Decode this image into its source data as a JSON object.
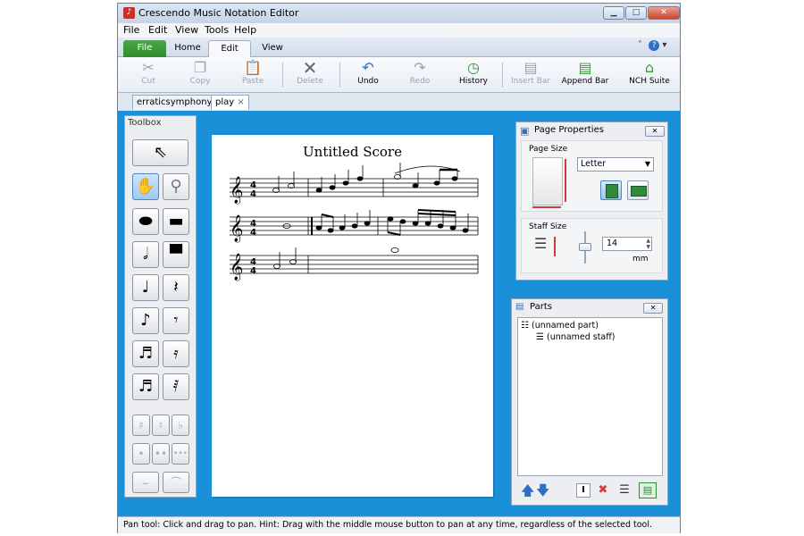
{
  "window": {
    "title": "Crescendo Music Notation Editor"
  },
  "menu": [
    "File",
    "Edit",
    "View",
    "Tools",
    "Help"
  ],
  "ribbon_tabs": {
    "file": "File",
    "home": "Home",
    "edit": "Edit",
    "view": "View"
  },
  "ribbon": {
    "cut": "Cut",
    "copy": "Copy",
    "paste": "Paste",
    "delete": "Delete",
    "undo": "Undo",
    "redo": "Redo",
    "history": "History",
    "insert_bar": "Insert Bar",
    "append_bar": "Append Bar",
    "nch_suite": "NCH Suite"
  },
  "doc_tabs": {
    "first": "erraticsymphony",
    "second": "play"
  },
  "toolbox": {
    "title": "Toolbox"
  },
  "score": {
    "title": "Untitled Score"
  },
  "page_properties": {
    "title": "Page Properties",
    "page_size_label": "Page Size",
    "page_size_value": "Letter",
    "staff_size_label": "Staff Size",
    "staff_size_value": "14",
    "staff_size_unit": "mm"
  },
  "parts": {
    "title": "Parts",
    "part_name": "(unnamed part)",
    "staff_name": "(unnamed staff)"
  },
  "status": "Pan tool: Click and drag to pan. Hint: Drag with the middle mouse button to pan at any time, regardless of the selected tool.",
  "icons": [
    "scissors-icon",
    "copy-icon",
    "paste-icon",
    "delete-icon",
    "undo-icon",
    "redo-icon",
    "history-icon",
    "insert-bar-icon",
    "append-bar-icon",
    "nch-suite-icon",
    "pointer-icon",
    "hand-icon",
    "zoom-icon",
    "whole-note-icon",
    "whole-rest-icon",
    "half-note-icon",
    "half-rest-icon",
    "quarter-note-icon",
    "quarter-rest-icon",
    "eighth-note-icon",
    "eighth-rest-icon",
    "sixteenth-note-icon",
    "sixteenth-rest-icon",
    "thirtysecond-note-icon",
    "thirtysecond-rest-icon",
    "sharp-icon",
    "natural-icon",
    "flat-icon",
    "dot-icon",
    "double-dot-icon",
    "triple-dot-icon",
    "tie-icon",
    "slur-icon"
  ],
  "colors": {
    "workarea": "#1a90d9",
    "file_tab": "#3a9a37",
    "close_button": "#c8442b"
  }
}
